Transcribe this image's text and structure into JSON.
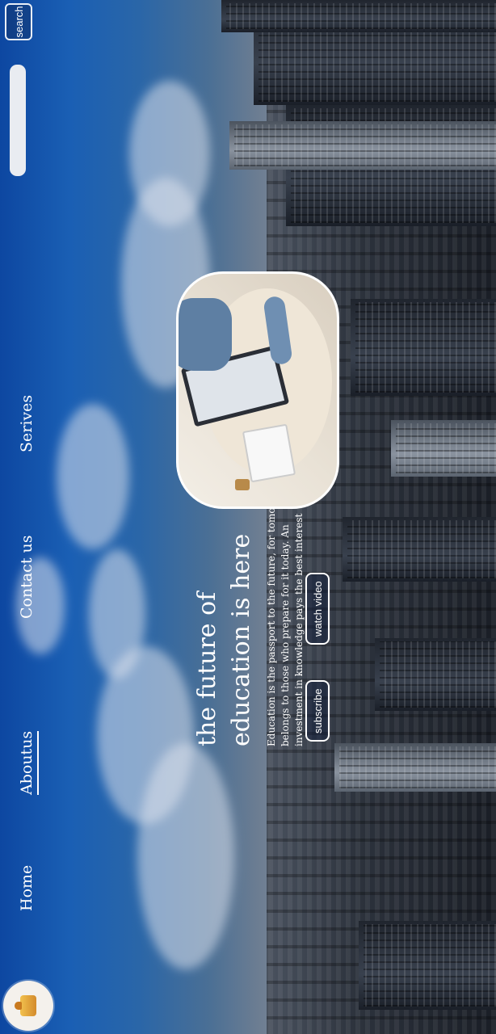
{
  "nav": {
    "logo_alt": "logo",
    "links": [
      {
        "label": "Home"
      },
      {
        "label": "Aboutus",
        "active": true
      },
      {
        "label": "Contact us"
      },
      {
        "label": "Serives"
      }
    ],
    "search": {
      "placeholder": "",
      "button_label": "search"
    }
  },
  "hero": {
    "title": "the future of education is here",
    "text": "Education is the passport to the future, for tomorrow belongs to those who prepare for it today. An investment in knowledge pays the best interest",
    "buttons": {
      "subscribe": "subscribe",
      "watch_video": "watch video"
    }
  },
  "colors": {
    "accent": "#ffffff",
    "sky": "#0d47a1"
  },
  "icons": {
    "logo": "learning-logo-icon"
  }
}
